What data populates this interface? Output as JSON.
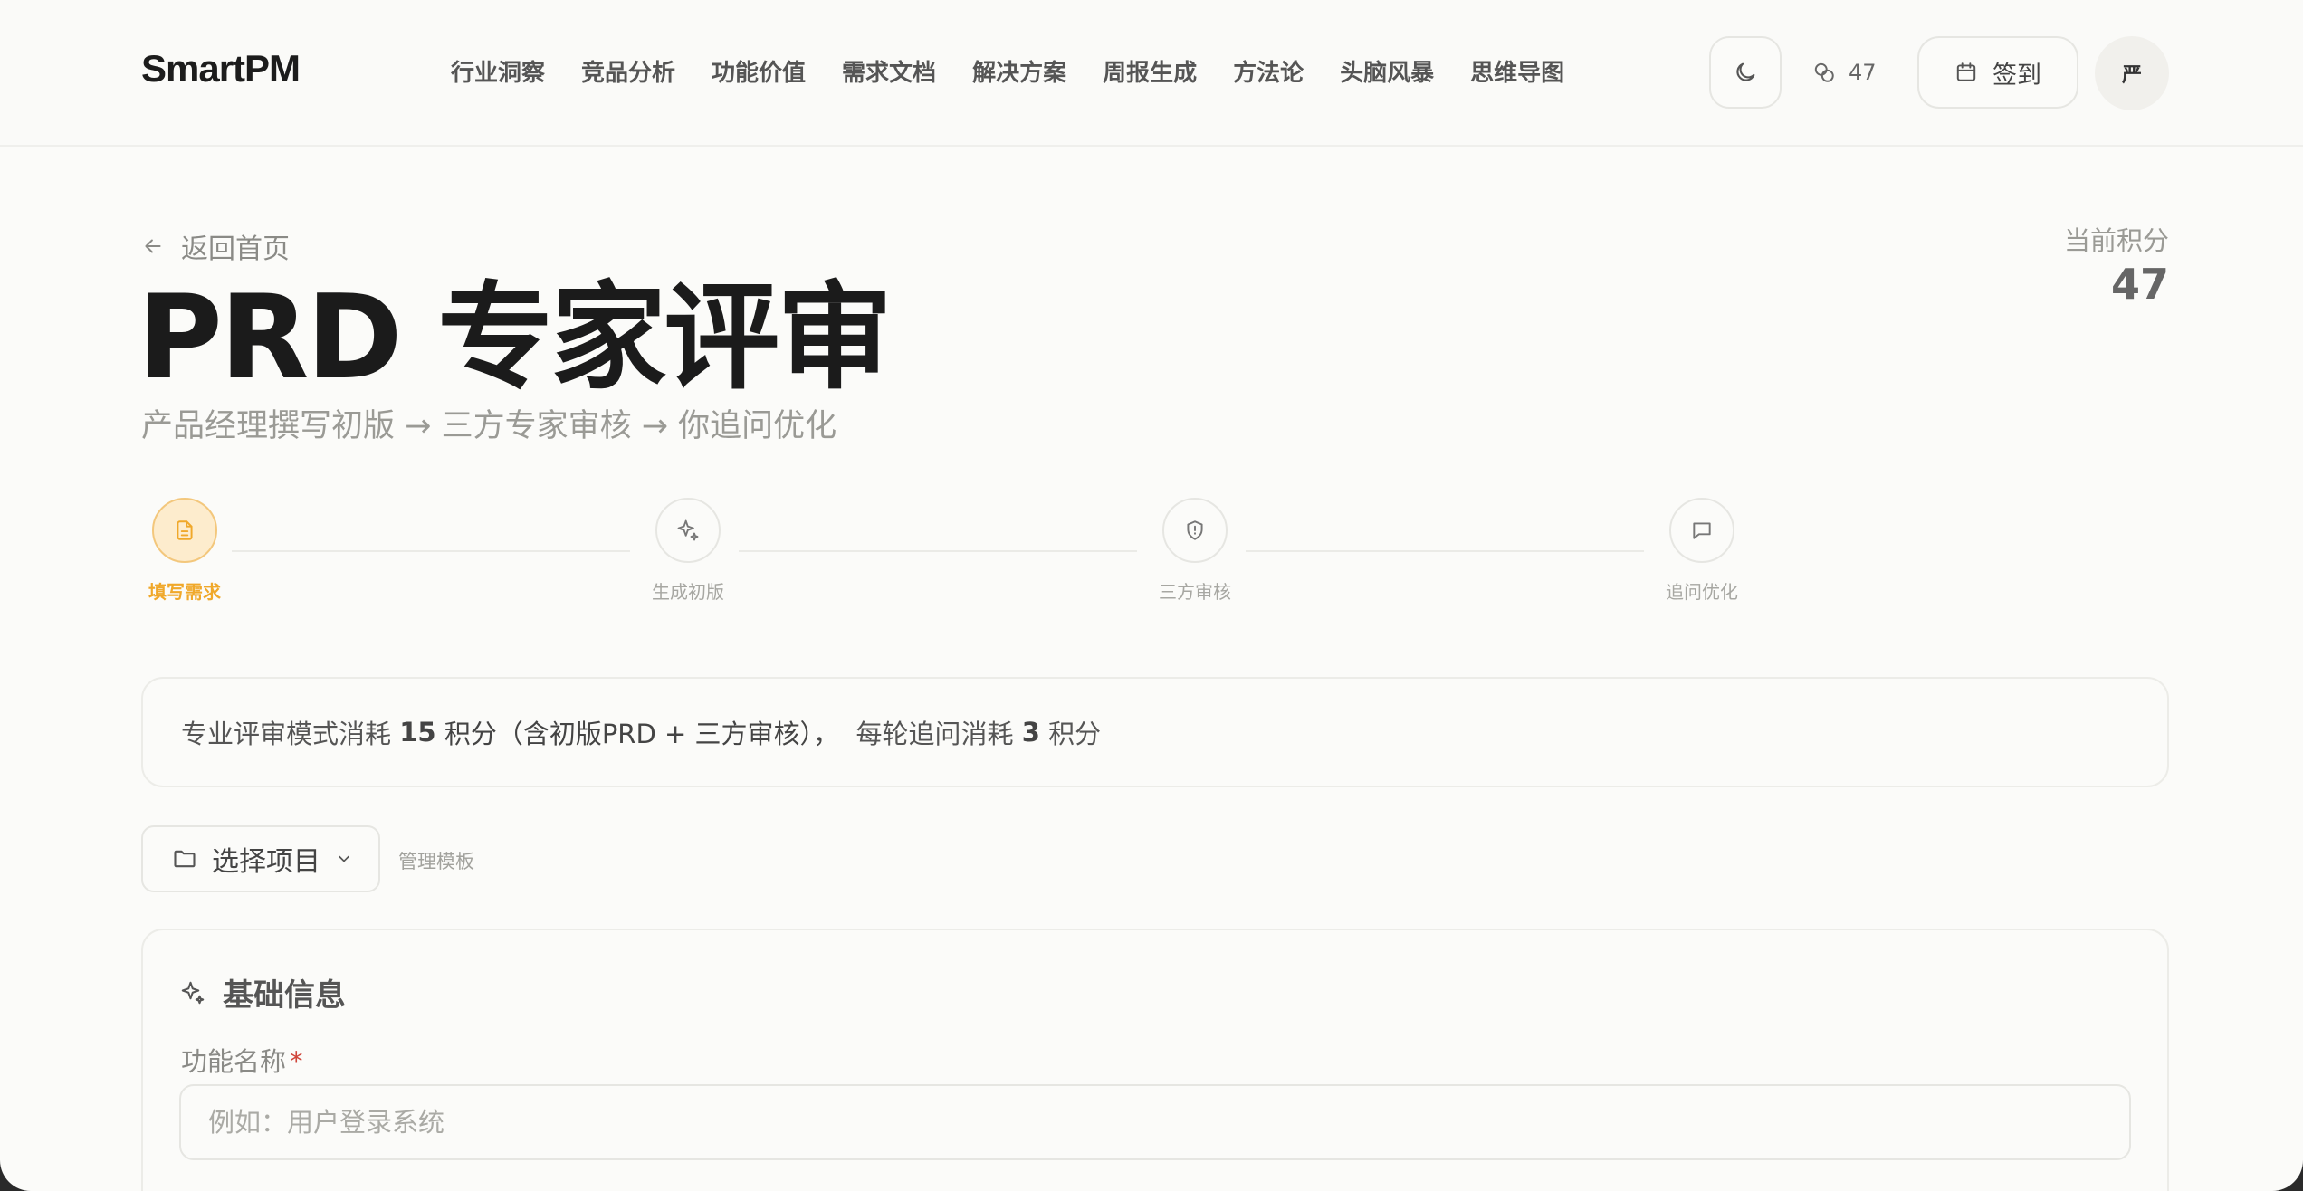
{
  "brand": "SmartPM",
  "nav": [
    {
      "label": "行业洞察"
    },
    {
      "label": "竞品分析"
    },
    {
      "label": "功能价值"
    },
    {
      "label": "需求文档"
    },
    {
      "label": "解决方案"
    },
    {
      "label": "周报生成"
    },
    {
      "label": "方法论"
    },
    {
      "label": "头脑风暴"
    },
    {
      "label": "思维导图"
    }
  ],
  "header": {
    "points": "47",
    "signin_label": "签到",
    "avatar_text": "严"
  },
  "page": {
    "back_label": "返回首页",
    "title": "PRD 专家评审",
    "subtitle": "产品经理撰写初版 → 三方专家审核 → 你追问优化",
    "score_label": "当前积分",
    "score_value": "47"
  },
  "steps": [
    {
      "label": "填写需求",
      "icon": "document-icon",
      "active": true
    },
    {
      "label": "生成初版",
      "icon": "sparkle-icon",
      "active": false
    },
    {
      "label": "三方审核",
      "icon": "shield-icon",
      "active": false
    },
    {
      "label": "追问优化",
      "icon": "chat-icon",
      "active": false
    }
  ],
  "banner": {
    "text_a": "专业评审模式消耗",
    "cost_a": "15",
    "text_b": "积分（含初版PRD + 三方审核），",
    "text_c": "每轮追问消耗",
    "cost_b": "3",
    "text_d": "积分"
  },
  "project": {
    "select_label": "选择项目",
    "manage_label": "管理模板"
  },
  "form": {
    "section_title": "基础信息",
    "feature_label": "功能名称",
    "required_mark": "*",
    "feature_placeholder": "例如：用户登录系统",
    "feature_value": ""
  },
  "colors": {
    "accent": "#f0a82a",
    "accent_bg": "#fdeccd",
    "required": "#d0453a"
  }
}
